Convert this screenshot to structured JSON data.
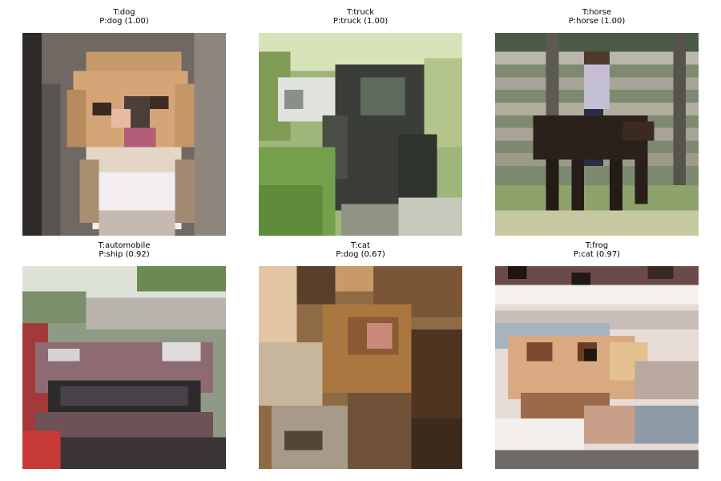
{
  "panels": [
    {
      "true_label": "T:dog",
      "pred_label": "P:dog (1.00)",
      "image": "small-dog-face"
    },
    {
      "true_label": "T:truck",
      "pred_label": "P:truck (1.00)",
      "image": "dark-truck-among-trees"
    },
    {
      "true_label": "T:horse",
      "pred_label": "P:horse (1.00)",
      "image": "rider-on-dark-horse-by-fence"
    },
    {
      "true_label": "T:automobile",
      "pred_label": "P:ship (0.92)",
      "image": "maroon-car-front-grille"
    },
    {
      "true_label": "T:cat",
      "pred_label": "P:dog (0.67)",
      "image": "brown-cat-close-up"
    },
    {
      "true_label": "T:frog",
      "pred_label": "P:cat (0.97)",
      "image": "frog-on-white-surface"
    }
  ]
}
